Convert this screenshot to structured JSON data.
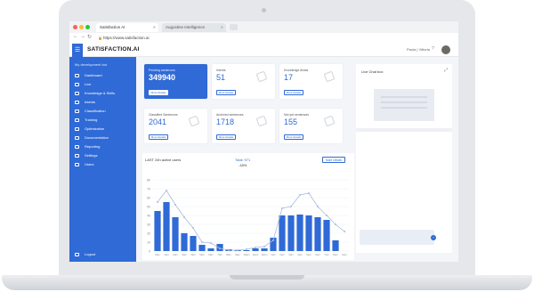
{
  "browser": {
    "active_tab_label": "Satisfaction AI",
    "inactive_tab_label": "Augustine Intelligence",
    "url": "https://www.satisfaction.ai"
  },
  "app": {
    "brand": "SATISFACTION.AI",
    "user_label": "Paola | Vittoria"
  },
  "sidebar": {
    "title": "My development bot",
    "items": [
      {
        "label": "Dashboard",
        "icon": "dashboard-icon"
      },
      {
        "label": "Live",
        "icon": "live-icon"
      },
      {
        "label": "Knowledge & Skills",
        "icon": "knowledge-icon"
      },
      {
        "label": "Intents",
        "icon": "intents-icon"
      },
      {
        "label": "Classification",
        "icon": "classification-icon"
      },
      {
        "label": "Training",
        "icon": "training-icon"
      },
      {
        "label": "Optimization",
        "icon": "optimization-icon"
      },
      {
        "label": "Documentation",
        "icon": "documentation-icon"
      },
      {
        "label": "Reporting",
        "icon": "reporting-icon"
      },
      {
        "label": "Settings",
        "icon": "settings-icon"
      },
      {
        "label": "Users",
        "icon": "users-icon"
      }
    ],
    "logout_label": "Logout"
  },
  "cards": [
    {
      "label": "Pending sentences",
      "value": "349940",
      "button": "More Details"
    },
    {
      "label": "Intents",
      "value": "51",
      "button": "More Details"
    },
    {
      "label": "Knowledge Areas",
      "value": "17",
      "button": "More Details"
    },
    {
      "label": "Classified Sentences",
      "value": "2041",
      "button": "More Details"
    },
    {
      "label": "Archived sentences",
      "value": "1718",
      "button": "More Details"
    },
    {
      "label": "Not yet sentences",
      "value": "155",
      "button": "More Details"
    }
  ],
  "chart": {
    "title": "LAST 24h active users",
    "total": "Total: 971",
    "delta": "-18%",
    "button": "More Details"
  },
  "live_panel": {
    "title": "Live Chat box"
  },
  "colors": {
    "accent": "#2f6ad6",
    "line_series": "#a9bbdf"
  },
  "chart_data": {
    "type": "bar",
    "title": "LAST 24h active users",
    "categories": [
      "0am",
      "1am",
      "2am",
      "3am",
      "4am",
      "5am",
      "6am",
      "7am",
      "8am",
      "9am",
      "10am",
      "11am",
      "12pm",
      "1pm",
      "2pm",
      "3pm",
      "4pm",
      "5pm",
      "6pm",
      "7pm",
      "8pm",
      "9pm"
    ],
    "ylim": [
      0,
      80
    ],
    "yticks": [
      0,
      10,
      20,
      30,
      40,
      50,
      60,
      70,
      80
    ],
    "series": [
      {
        "values": [
          45,
          55,
          38,
          20,
          17,
          7,
          3,
          8,
          2,
          1,
          1,
          3,
          3,
          15,
          40,
          40,
          41,
          40,
          38,
          35,
          12
        ]
      },
      {
        "values": [
          55,
          68,
          52,
          38,
          26,
          10,
          9,
          3,
          1,
          1,
          2,
          4,
          5,
          12,
          48,
          50,
          63,
          65,
          50,
          40,
          30,
          22
        ]
      }
    ]
  }
}
